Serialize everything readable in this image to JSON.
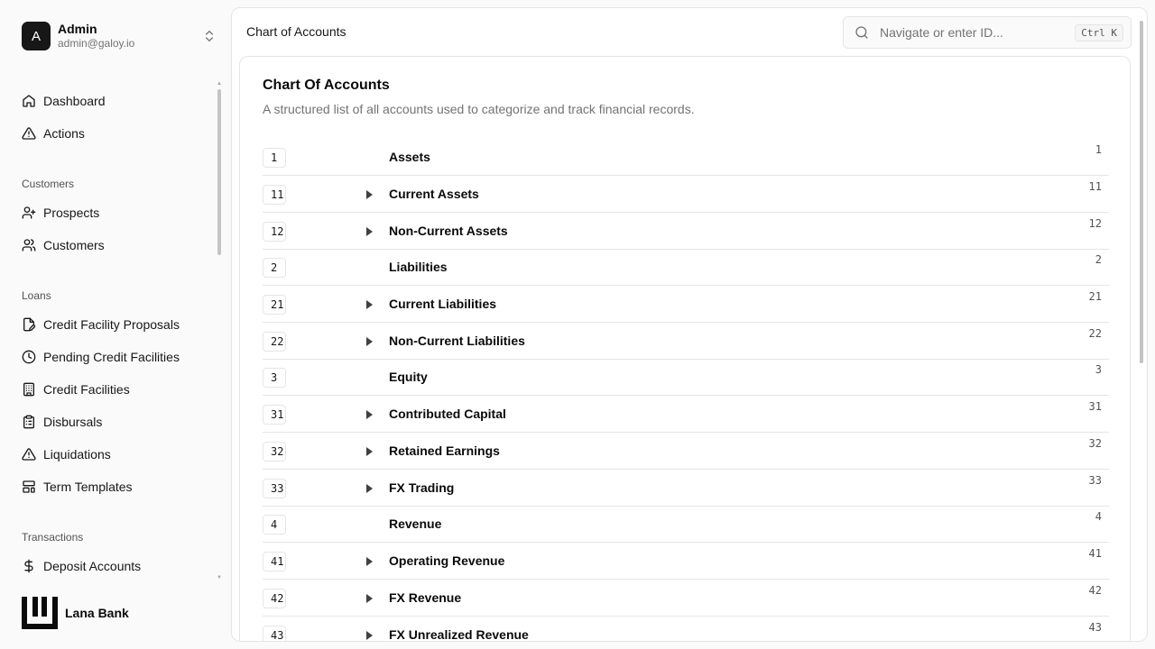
{
  "user": {
    "avatar_letter": "A",
    "name": "Admin",
    "email": "admin@galoy.io"
  },
  "nav": {
    "top": [
      {
        "label": "Dashboard",
        "icon": "home-icon"
      },
      {
        "label": "Actions",
        "icon": "alert-triangle-icon"
      }
    ],
    "groups": [
      {
        "title": "Customers",
        "items": [
          {
            "label": "Prospects",
            "icon": "user-plus-icon"
          },
          {
            "label": "Customers",
            "icon": "users-icon"
          }
        ]
      },
      {
        "title": "Loans",
        "items": [
          {
            "label": "Credit Facility Proposals",
            "icon": "file-edit-icon"
          },
          {
            "label": "Pending Credit Facilities",
            "icon": "clock-icon"
          },
          {
            "label": "Credit Facilities",
            "icon": "building-icon"
          },
          {
            "label": "Disbursals",
            "icon": "clipboard-list-icon"
          },
          {
            "label": "Liquidations",
            "icon": "alert-triangle-icon"
          },
          {
            "label": "Term Templates",
            "icon": "layout-template-icon"
          }
        ]
      },
      {
        "title": "Transactions",
        "items": [
          {
            "label": "Deposit Accounts",
            "icon": "dollar-icon"
          }
        ]
      }
    ]
  },
  "brand": {
    "name": "Lana Bank"
  },
  "topbar": {
    "title": "Chart of Accounts",
    "search_placeholder": "Navigate or enter ID...",
    "shortcut": "Ctrl K"
  },
  "card": {
    "title": "Chart Of Accounts",
    "description": "A structured list of all accounts used to categorize and track financial records."
  },
  "accounts": [
    {
      "code": "1",
      "name": "Assets",
      "expandable": false
    },
    {
      "code": "11",
      "name": "Current Assets",
      "expandable": true
    },
    {
      "code": "12",
      "name": "Non-Current Assets",
      "expandable": true
    },
    {
      "code": "2",
      "name": "Liabilities",
      "expandable": false
    },
    {
      "code": "21",
      "name": "Current Liabilities",
      "expandable": true
    },
    {
      "code": "22",
      "name": "Non-Current Liabilities",
      "expandable": true
    },
    {
      "code": "3",
      "name": "Equity",
      "expandable": false
    },
    {
      "code": "31",
      "name": "Contributed Capital",
      "expandable": true
    },
    {
      "code": "32",
      "name": "Retained Earnings",
      "expandable": true
    },
    {
      "code": "33",
      "name": "FX Trading",
      "expandable": true
    },
    {
      "code": "4",
      "name": "Revenue",
      "expandable": false
    },
    {
      "code": "41",
      "name": "Operating Revenue",
      "expandable": true
    },
    {
      "code": "42",
      "name": "FX Revenue",
      "expandable": true
    },
    {
      "code": "43",
      "name": "FX Unrealized Revenue",
      "expandable": true
    }
  ]
}
